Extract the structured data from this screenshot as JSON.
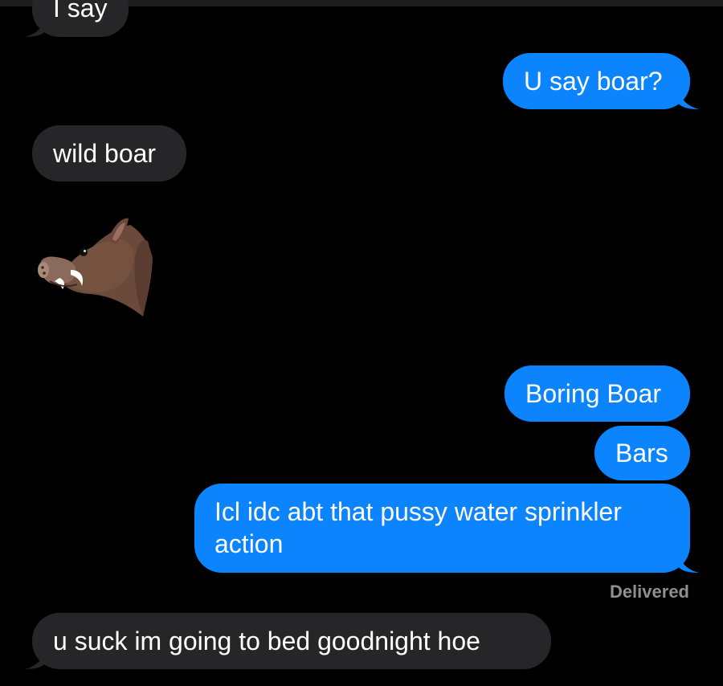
{
  "messages": [
    {
      "direction": "received",
      "text": "I say"
    },
    {
      "direction": "sent",
      "text": "U say boar?"
    },
    {
      "direction": "received",
      "text": "wild boar"
    },
    {
      "direction": "received",
      "emoji": "boar-emoji"
    },
    {
      "direction": "sent",
      "text": "Boring Boar"
    },
    {
      "direction": "sent",
      "text": "Bars"
    },
    {
      "direction": "sent",
      "text_line1": "Icl idc abt that pussy water sprinkler",
      "text_line2": "action"
    },
    {
      "direction": "received",
      "text": "u suck im going to bed goodnight hoe"
    }
  ],
  "status": {
    "delivered": "Delivered"
  },
  "colors": {
    "sent_bubble": "#0b84fe",
    "received_bubble": "#262629",
    "background": "#000000",
    "status_text": "#8e8e93"
  }
}
